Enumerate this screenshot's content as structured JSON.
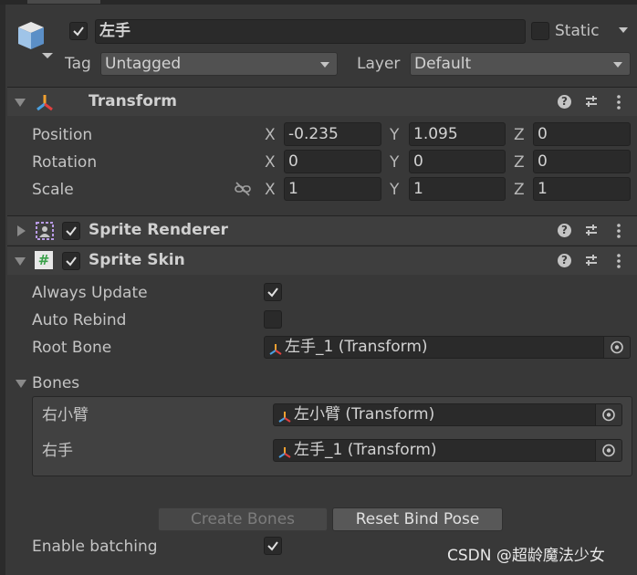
{
  "object": {
    "name": "左手",
    "active": true,
    "static_label": "Static",
    "static_checked": false,
    "tag_label": "Tag",
    "tag_value": "Untagged",
    "layer_label": "Layer",
    "layer_value": "Default"
  },
  "transform": {
    "title": "Transform",
    "rows": [
      {
        "label": "Position",
        "x": "-0.235",
        "y": "1.095",
        "z": "0"
      },
      {
        "label": "Rotation",
        "x": "0",
        "y": "0",
        "z": "0"
      },
      {
        "label": "Scale",
        "x": "1",
        "y": "1",
        "z": "1"
      }
    ],
    "axis": {
      "x": "X",
      "y": "Y",
      "z": "Z"
    }
  },
  "sprite_renderer": {
    "title": "Sprite Renderer",
    "enabled": true
  },
  "sprite_skin": {
    "title": "Sprite Skin",
    "enabled": true,
    "always_update_label": "Always Update",
    "always_update": true,
    "auto_rebind_label": "Auto Rebind",
    "auto_rebind": false,
    "root_bone_label": "Root Bone",
    "root_bone_value": "左手_1 (Transform)",
    "bones_label": "Bones",
    "bones": [
      {
        "label": "右小臂",
        "value": "左小臂 (Transform)"
      },
      {
        "label": "右手",
        "value": "左手_1 (Transform)"
      }
    ],
    "create_bones_label": "Create Bones",
    "reset_bind_pose_label": "Reset Bind Pose",
    "enable_batching_label": "Enable batching",
    "enable_batching": true
  },
  "watermark": "CSDN @超龄魔法少女"
}
